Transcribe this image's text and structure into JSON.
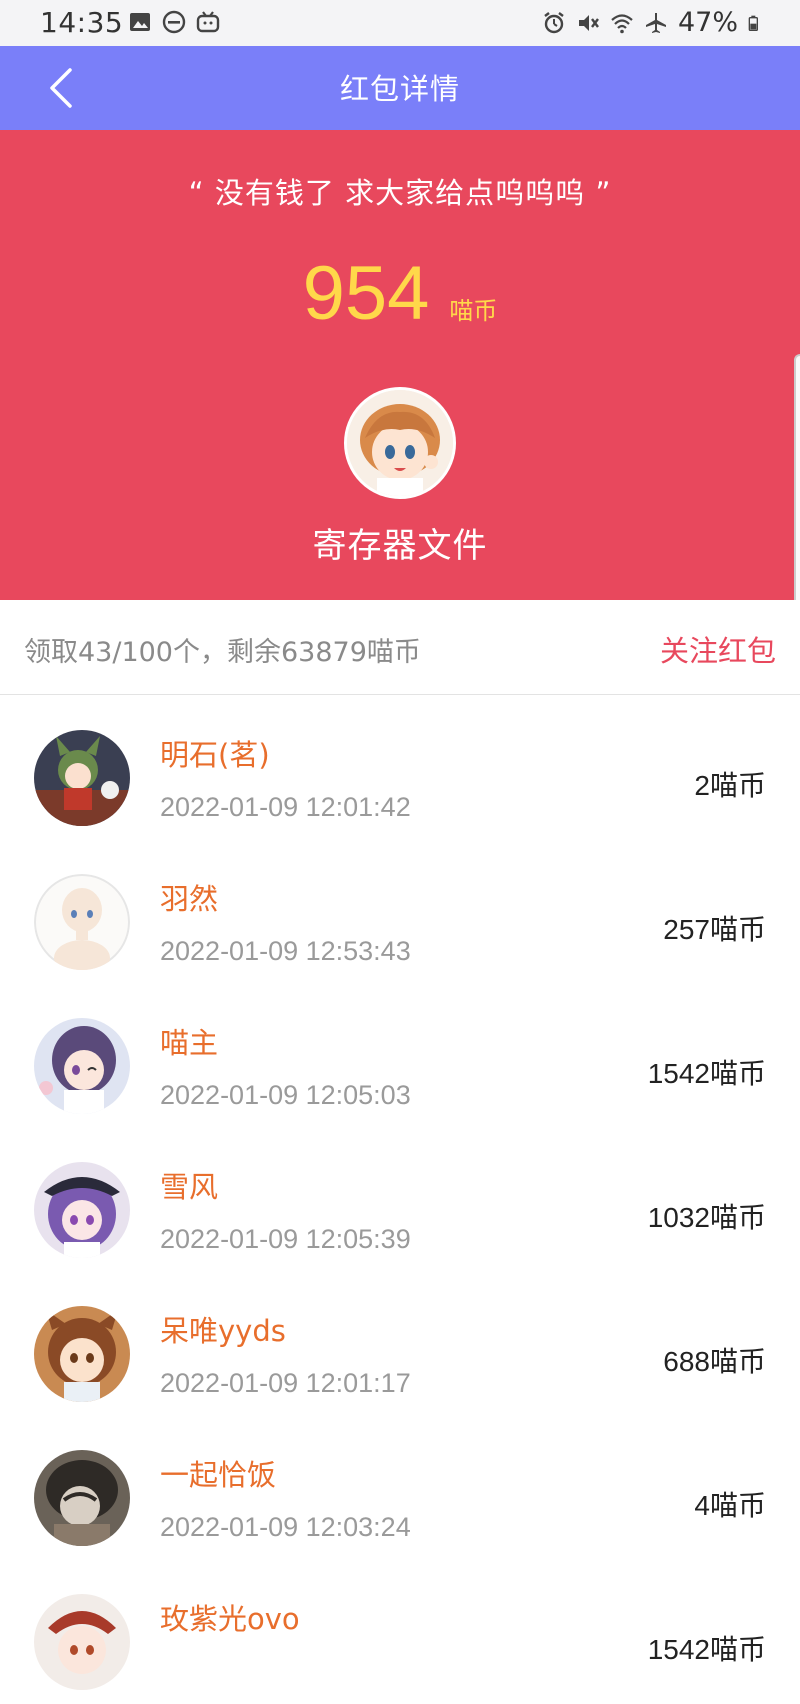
{
  "status_bar": {
    "time": "14:35",
    "battery": "47%",
    "left_icons": [
      "image-icon",
      "dnd-icon",
      "tv-icon"
    ],
    "right_icons": [
      "alarm-icon",
      "mute-icon",
      "wifi-icon",
      "airplane-icon",
      "battery-icon"
    ]
  },
  "nav": {
    "title": "红包详情",
    "back_icon": "chevron-left-icon"
  },
  "hero": {
    "message": "“ 没有钱了 求大家给点呜呜呜 ”",
    "amount": "954",
    "unit": "喵币",
    "sender_name": "寄存器文件"
  },
  "summary": {
    "text": "领取43/100个，剩余63879喵币",
    "follow": "关注红包"
  },
  "colors": {
    "nav_bg": "#7a7ff9",
    "hero_bg": "#e8485d",
    "amount_yellow": "#ffd84a",
    "name_orange": "#e86e2c"
  },
  "claims": [
    {
      "name": "明石(茗)",
      "time": "2022-01-09 12:01:42",
      "amount": "2喵币"
    },
    {
      "name": "羽然",
      "time": "2022-01-09 12:53:43",
      "amount": "257喵币"
    },
    {
      "name": "喵主",
      "time": "2022-01-09 12:05:03",
      "amount": "1542喵币"
    },
    {
      "name": "雪风",
      "time": "2022-01-09 12:05:39",
      "amount": "1032喵币"
    },
    {
      "name": "呆唯yyds",
      "time": "2022-01-09 12:01:17",
      "amount": "688喵币"
    },
    {
      "name": "一起恰饭",
      "time": "2022-01-09 12:03:24",
      "amount": "4喵币"
    },
    {
      "name": "玫紫光ovo",
      "time": "",
      "amount": "1542喵币"
    }
  ]
}
